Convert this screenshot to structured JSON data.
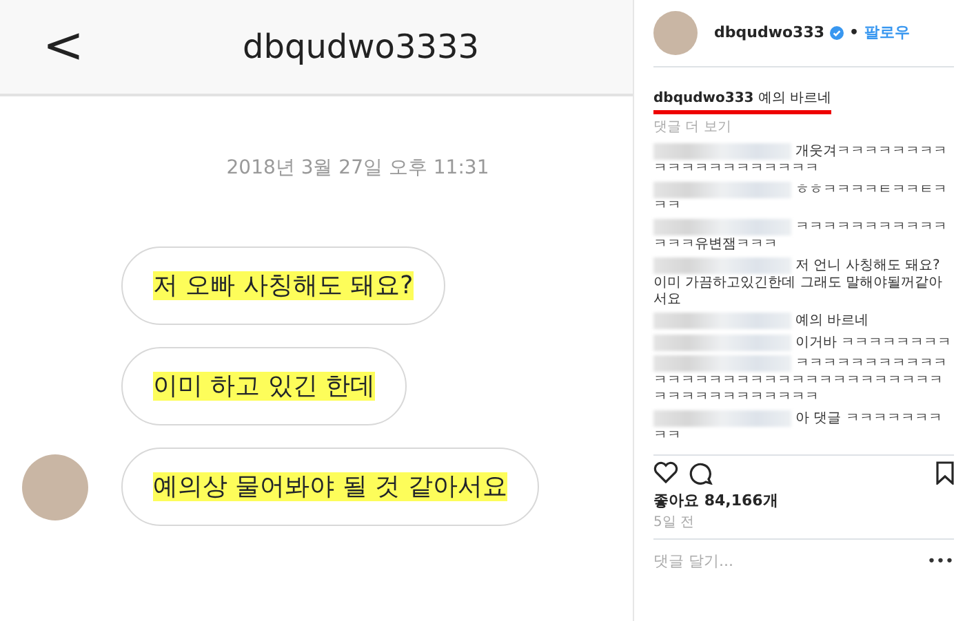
{
  "chat": {
    "back": "<",
    "title": "dbqudwo3333",
    "timestamp": "2018년 3월 27일 오후 11:31",
    "messages": [
      {
        "text": "저 오빠 사칭해도 돼요?",
        "show_avatar": false
      },
      {
        "text": "이미 하고 있긴 한데",
        "show_avatar": false
      },
      {
        "text": "예의상 물어봐야 될 것 같아서요",
        "show_avatar": true
      }
    ]
  },
  "post": {
    "username": "dbqudwo333",
    "verified": true,
    "separator": "•",
    "follow": "팔로우",
    "caption": {
      "username": "dbqudwo333",
      "text": "예의 바르네",
      "underlined": true
    },
    "more_comments": "댓글 더 보기",
    "comments": [
      {
        "text": "개웃겨ㅋㅋㅋㅋㅋㅋㅋㅋㅋㅋㅋㅋㅋㅋㅋㅋㅋㅋㅋㅋ"
      },
      {
        "text": "ㅎㅎㅋㅋㅋㅋㅌㅋㅋㅌㅋㅋㅋ"
      },
      {
        "text": "ㅋㅋㅋㅋㅋㅋㅋㅋㅋㅋㅋㅋㅋㅋ유변잼ㅋㅋㅋ"
      },
      {
        "text": "저 언니 사칭해도 돼요? 이미 가끔하고있긴한데 그래도 말해야될꺼같아서요"
      },
      {
        "text": "예의 바르네"
      },
      {
        "text": "이거바 ㅋㅋㅋㅋㅋㅋㅋㅋ"
      },
      {
        "text": "ㅋㅋㅋㅋㅋㅋㅋㅋㅋㅋㅋㅋㅋㅋㅋㅋㅋㅋㅋㅋㅋㅋㅋㅋㅋㅋㅋㅋㅋㅋㅋㅋㅋㅋㅋㅋㅋㅋㅋㅋㅋㅋㅋㅋ"
      },
      {
        "text": "아 댓글 ㅋㅋㅋㅋㅋㅋㅋㅋㅋ"
      }
    ],
    "likes": "좋아요 84,166개",
    "time": "5일 전",
    "comment_placeholder": "댓글 달기...",
    "more": "•••"
  }
}
